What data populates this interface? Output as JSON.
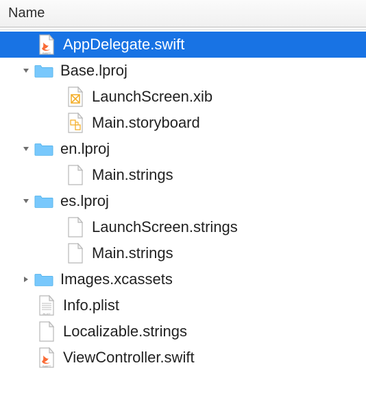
{
  "header": {
    "name_col": "Name"
  },
  "tree": {
    "items": [
      {
        "label": "AppDelegate.swift",
        "icon": "swift-file-icon",
        "selected": true,
        "depth": 1,
        "folder": false,
        "disclosure": null
      },
      {
        "label": "Base.lproj",
        "icon": "folder-icon",
        "selected": false,
        "depth": 0,
        "folder": true,
        "disclosure": "open"
      },
      {
        "label": "LaunchScreen.xib",
        "icon": "xib-file-icon",
        "selected": false,
        "depth": 2,
        "folder": false,
        "disclosure": null
      },
      {
        "label": "Main.storyboard",
        "icon": "storyboard-file-icon",
        "selected": false,
        "depth": 2,
        "folder": false,
        "disclosure": null
      },
      {
        "label": "en.lproj",
        "icon": "folder-icon",
        "selected": false,
        "depth": 0,
        "folder": true,
        "disclosure": "open"
      },
      {
        "label": "Main.strings",
        "icon": "blank-file-icon",
        "selected": false,
        "depth": 2,
        "folder": false,
        "disclosure": null
      },
      {
        "label": "es.lproj",
        "icon": "folder-icon",
        "selected": false,
        "depth": 0,
        "folder": true,
        "disclosure": "open"
      },
      {
        "label": "LaunchScreen.strings",
        "icon": "blank-file-icon",
        "selected": false,
        "depth": 2,
        "folder": false,
        "disclosure": null
      },
      {
        "label": "Main.strings",
        "icon": "blank-file-icon",
        "selected": false,
        "depth": 2,
        "folder": false,
        "disclosure": null
      },
      {
        "label": "Images.xcassets",
        "icon": "folder-icon",
        "selected": false,
        "depth": 0,
        "folder": true,
        "disclosure": "closed"
      },
      {
        "label": "Info.plist",
        "icon": "plist-file-icon",
        "selected": false,
        "depth": 1,
        "folder": false,
        "disclosure": null
      },
      {
        "label": "Localizable.strings",
        "icon": "blank-file-icon",
        "selected": false,
        "depth": 1,
        "folder": false,
        "disclosure": null
      },
      {
        "label": "ViewController.swift",
        "icon": "swift-file-icon",
        "selected": false,
        "depth": 1,
        "folder": false,
        "disclosure": null
      }
    ]
  }
}
